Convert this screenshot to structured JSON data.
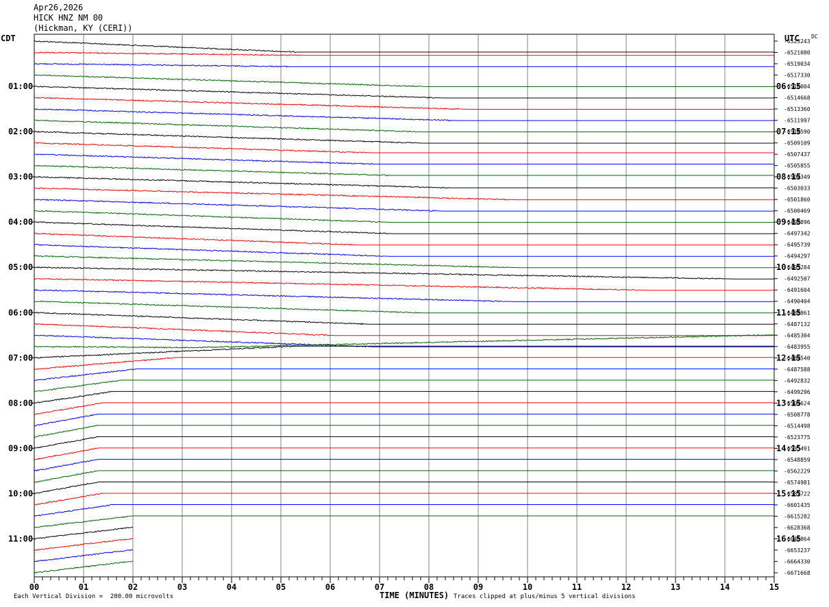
{
  "header": {
    "date": "Apr26,2026",
    "station": "HICK HNZ NM 00",
    "location": "(Hickman, KY (CERI))"
  },
  "left_tz": "CDT",
  "right_tz": "UTC",
  "dc_label": "DC",
  "footer": {
    "scale_note": "Each Vertical Division =  200.00 microvolts",
    "clip_note": "Traces clipped at plus/minus 5 vertical divisions",
    "xlabel": "TIME (MINUTES)"
  },
  "colors": {
    "black": "#000000",
    "red": "#ff0000",
    "blue": "#0000ff",
    "green": "#006400",
    "grid": "#808080"
  },
  "chart_data": {
    "type": "line",
    "x_ticks": [
      "00",
      "01",
      "02",
      "03",
      "04",
      "05",
      "06",
      "07",
      "08",
      "09",
      "10",
      "11",
      "12",
      "13",
      "14",
      "15"
    ],
    "xlim": [
      0,
      15
    ],
    "minutes_per_trace": 15,
    "left_hour_labels": [
      "01:00",
      "02:00",
      "03:00",
      "04:00",
      "05:00",
      "06:00",
      "07:00",
      "08:00",
      "09:00",
      "10:00",
      "11:00"
    ],
    "right_hour_labels": [
      "06:15",
      "07:15",
      "08:15",
      "09:15",
      "10:15",
      "11:15",
      "12:15",
      "13:15",
      "14:15",
      "15:15",
      "16:15"
    ],
    "dc_offsets": [
      "-6523243",
      "-6521080",
      "-6519034",
      "-6517330",
      "-6516004",
      "-6514668",
      "-6513360",
      "-6511997",
      "-6510590",
      "-6509109",
      "-6507437",
      "-6505855",
      "-6504349",
      "-6503033",
      "-6501860",
      "-6500469",
      "-6498896",
      "-6497342",
      "-6495739",
      "-6494297",
      "-6493284",
      "-6492507",
      "-6491604",
      "-6490404",
      "-6488861",
      "-6487132",
      "-6485304",
      "-6483955",
      "-6484540",
      "-6487588",
      "-6492832",
      "-6499296",
      "-6504624",
      "-6508778",
      "-6514498",
      "-6523775",
      "-6535491",
      "-6548859",
      "-6562229",
      "-6574981",
      "-6587722",
      "-6601435",
      "-6615282",
      "-6628368",
      "-6640864",
      "-6653237",
      "-6664330",
      "-6671668"
    ],
    "trace_colors": [
      "black",
      "red",
      "blue",
      "green"
    ],
    "series": [
      {
        "x": [
          0,
          5.3
        ],
        "y": [
          0,
          -5
        ]
      },
      {
        "x": [
          0,
          5.4
        ],
        "y": [
          0,
          -1.3
        ]
      },
      {
        "x": [
          0,
          5.2
        ],
        "y": [
          0,
          -1.3
        ]
      },
      {
        "x": [
          0,
          8.0
        ],
        "y": [
          0,
          -5.3
        ]
      },
      {
        "x": [
          0,
          8.3
        ],
        "y": [
          0,
          -5.3
        ]
      },
      {
        "x": [
          0,
          8.8
        ],
        "y": [
          0,
          -5.3
        ]
      },
      {
        "x": [
          0,
          8.6
        ],
        "y": [
          0,
          -5.3
        ]
      },
      {
        "x": [
          0,
          7.9
        ],
        "y": [
          0,
          -5.3
        ]
      },
      {
        "x": [
          0,
          7.9
        ],
        "y": [
          0,
          -5.3
        ]
      },
      {
        "x": [
          0,
          6.8
        ],
        "y": [
          0,
          -4.5
        ]
      },
      {
        "x": [
          0,
          6.9
        ],
        "y": [
          0,
          -4.5
        ]
      },
      {
        "x": [
          0,
          7.2
        ],
        "y": [
          0,
          -4.5
        ]
      },
      {
        "x": [
          0,
          8.4
        ],
        "y": [
          0,
          -5.0
        ]
      },
      {
        "x": [
          0,
          9.8
        ],
        "y": [
          0,
          -5.3
        ]
      },
      {
        "x": [
          0,
          8.3
        ],
        "y": [
          0,
          -5.3
        ]
      },
      {
        "x": [
          0,
          7.3
        ],
        "y": [
          0,
          -5.3
        ]
      },
      {
        "x": [
          0,
          7.3
        ],
        "y": [
          0,
          -5.3
        ]
      },
      {
        "x": [
          0,
          6.6
        ],
        "y": [
          0,
          -5.3
        ]
      },
      {
        "x": [
          0,
          7.2
        ],
        "y": [
          0,
          -5.3
        ]
      },
      {
        "x": [
          0,
          9.8
        ],
        "y": [
          0,
          -5.3
        ]
      },
      {
        "x": [
          0,
          14.2
        ],
        "y": [
          0,
          -5.3
        ]
      },
      {
        "x": [
          0,
          12.5
        ],
        "y": [
          0,
          -5.3
        ]
      },
      {
        "x": [
          0,
          9.7
        ],
        "y": [
          0,
          -5.3
        ]
      },
      {
        "x": [
          0,
          7.9
        ],
        "y": [
          0,
          -5.3
        ]
      },
      {
        "x": [
          0,
          6.8
        ],
        "y": [
          0,
          -5.3
        ]
      },
      {
        "x": [
          0,
          6.1
        ],
        "y": [
          0,
          -5.3
        ]
      },
      {
        "x": [
          0,
          6.9
        ],
        "y": [
          0,
          -5.3
        ]
      },
      {
        "x": [
          0,
          3.2,
          15
        ],
        "y": [
          0,
          -0.5,
          5.3
        ]
      },
      {
        "x": [
          0,
          5.3,
          15
        ],
        "y": [
          0,
          5.3,
          5.3
        ]
      },
      {
        "x": [
          0,
          2.9,
          15
        ],
        "y": [
          0,
          5.3,
          5.3
        ]
      },
      {
        "x": [
          0,
          2.1,
          15
        ],
        "y": [
          0,
          5.3,
          5.3
        ]
      },
      {
        "x": [
          0,
          1.8,
          15
        ],
        "y": [
          0,
          5.3,
          5.3
        ]
      },
      {
        "x": [
          0,
          1.6,
          15
        ],
        "y": [
          0,
          5.3,
          5.3
        ]
      },
      {
        "x": [
          0,
          1.4,
          15
        ],
        "y": [
          0,
          5.3,
          5.3
        ]
      },
      {
        "x": [
          0,
          1.3,
          15
        ],
        "y": [
          0,
          5.3,
          5.3
        ]
      },
      {
        "x": [
          0,
          1.3,
          15
        ],
        "y": [
          0,
          5.3,
          5.3
        ]
      },
      {
        "x": [
          0,
          1.3,
          15
        ],
        "y": [
          0,
          5.3,
          5.3
        ]
      },
      {
        "x": [
          0,
          1.3,
          15
        ],
        "y": [
          0,
          5.3,
          5.3
        ]
      },
      {
        "x": [
          0,
          1.3,
          15
        ],
        "y": [
          0,
          5.3,
          5.3
        ]
      },
      {
        "x": [
          0,
          1.3,
          15
        ],
        "y": [
          0,
          5.3,
          5.3
        ]
      },
      {
        "x": [
          0,
          1.3,
          15
        ],
        "y": [
          0,
          5.3,
          5.3
        ]
      },
      {
        "x": [
          0,
          1.4,
          15
        ],
        "y": [
          0,
          5.3,
          5.3
        ]
      },
      {
        "x": [
          0,
          1.6,
          15
        ],
        "y": [
          0,
          5.3,
          5.3
        ]
      },
      {
        "x": [
          0,
          2.0,
          15
        ],
        "y": [
          0,
          5.3,
          5.3
        ]
      },
      {
        "x": [
          0,
          2.0
        ],
        "y": [
          0,
          5.3
        ]
      },
      {
        "x": [
          0,
          2.0
        ],
        "y": [
          0,
          5.3
        ]
      },
      {
        "x": [
          0,
          2.0
        ],
        "y": [
          0,
          5.3
        ]
      },
      {
        "x": [
          0,
          2.0
        ],
        "y": [
          0,
          5.3
        ]
      }
    ]
  }
}
